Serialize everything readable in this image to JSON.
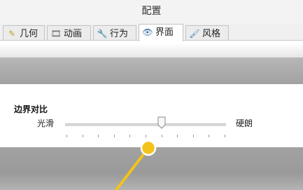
{
  "window": {
    "title": "配置"
  },
  "tabs": [
    {
      "label": "几何",
      "icon": "ruler-pencil-icon",
      "active": false
    },
    {
      "label": "动画",
      "icon": "film-icon",
      "active": false
    },
    {
      "label": "行为",
      "icon": "wrench-icon",
      "active": false
    },
    {
      "label": "界面",
      "icon": "eye-icon",
      "active": true
    },
    {
      "label": "风格",
      "icon": "brush-icon",
      "active": false
    }
  ],
  "section": {
    "title": "边界对比",
    "slider": {
      "min_label": "光滑",
      "max_label": "硬朗",
      "value_fraction": 0.6,
      "tick_count": 11
    }
  },
  "annotation": {
    "marker_color": "#f2c31b",
    "line_color": "#f2c31b"
  }
}
